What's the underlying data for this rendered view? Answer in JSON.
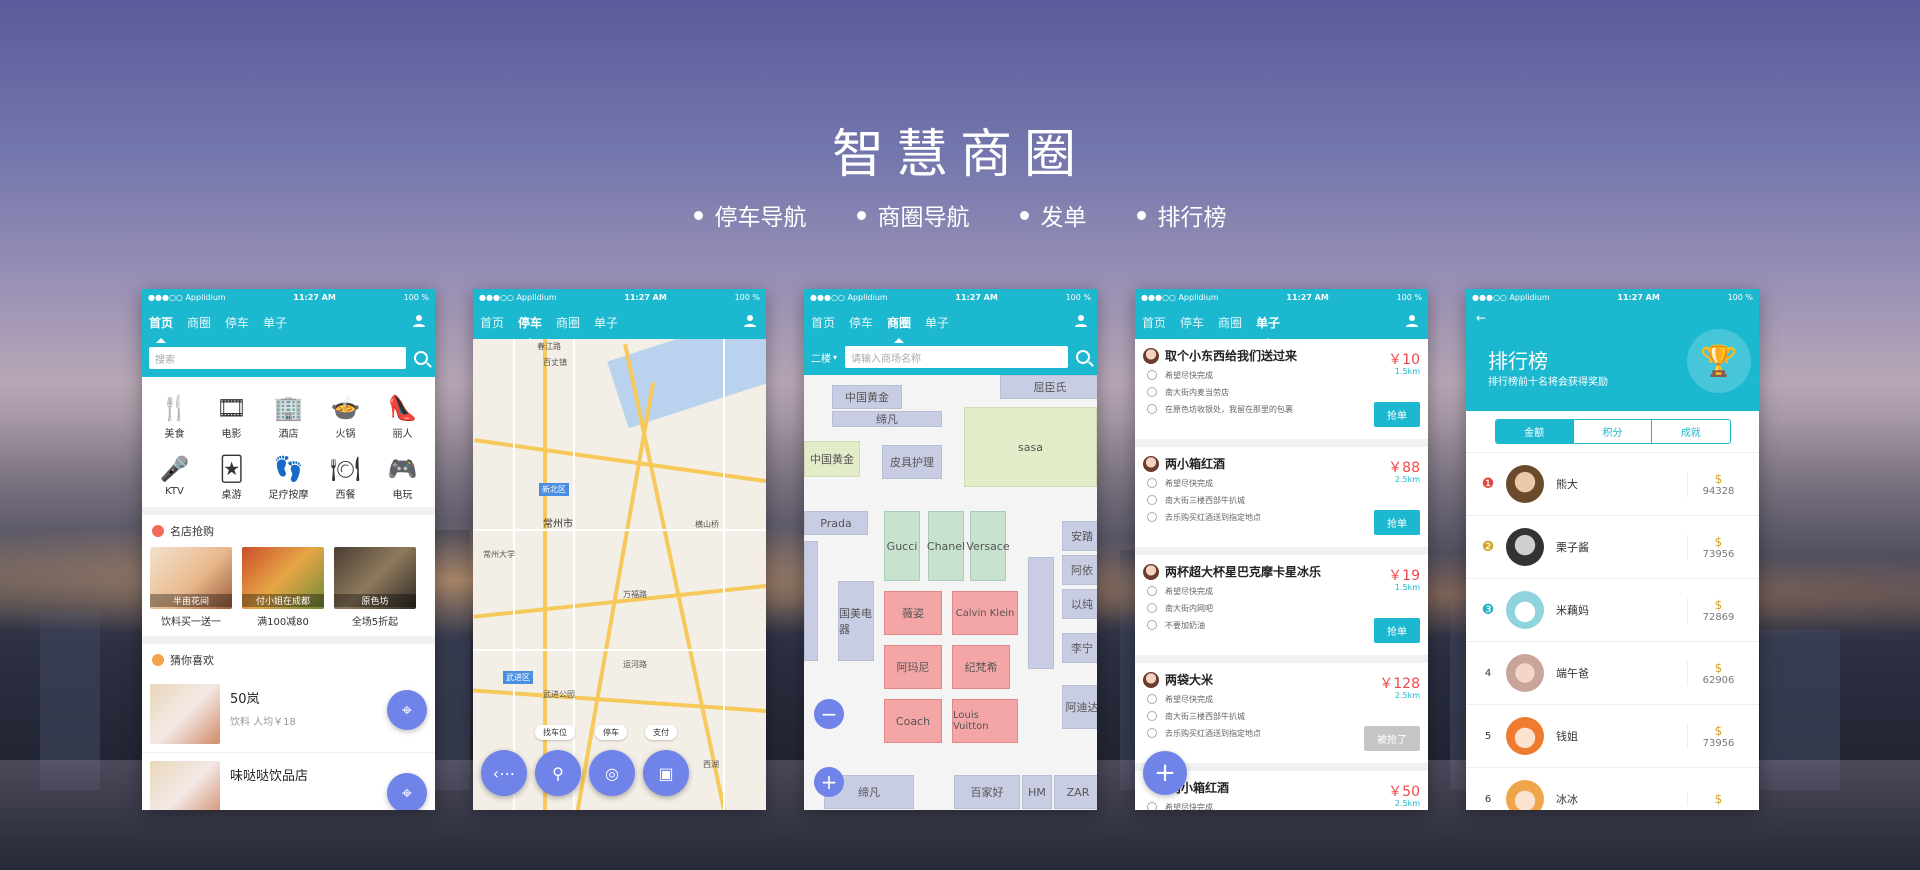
{
  "headline": "智慧商圈",
  "bullets": [
    "停车导航",
    "商圈导航",
    "发单",
    "排行榜"
  ],
  "status": {
    "carrier": "●●●○○ Applidium",
    "time": "11:27 AM",
    "battery": "100 %"
  },
  "nav": [
    "首页",
    "商圈",
    "停车",
    "单子"
  ],
  "nav2": [
    "首页",
    "停车",
    "商圈",
    "单子"
  ],
  "p1": {
    "search_placeholder": "搜索",
    "cats": [
      {
        "label": "美食",
        "icon": "🍴"
      },
      {
        "label": "电影",
        "icon": "🎞"
      },
      {
        "label": "酒店",
        "icon": "🏢"
      },
      {
        "label": "火锅",
        "icon": "🍲"
      },
      {
        "label": "丽人",
        "icon": "👠"
      },
      {
        "label": "KTV",
        "icon": "🎤"
      },
      {
        "label": "桌游",
        "icon": "🃏"
      },
      {
        "label": "足疗按摩",
        "icon": "👣"
      },
      {
        "label": "西餐",
        "icon": "🍽"
      },
      {
        "label": "电玩",
        "icon": "🎮"
      }
    ],
    "sec1": "名店抢购",
    "deals": [
      {
        "tag": "半亩花间",
        "cap": "饮料买一送一"
      },
      {
        "tag": "付小姐在成都",
        "cap": "满100减80"
      },
      {
        "tag": "原色坊",
        "cap": "全场5折起"
      }
    ],
    "sec2": "猜你喜欢",
    "shops": [
      {
        "name": "50岚",
        "sub": "饮料  人均￥18"
      },
      {
        "name": "味哒哒饮品店",
        "sub": ""
      }
    ]
  },
  "p2": {
    "labels": [
      "春江路",
      "百丈镇",
      "常州市",
      "新北区",
      "武进区",
      "常州大学",
      "武进公园",
      "横山桥",
      "万福路",
      "西湖",
      "运河路"
    ],
    "chips": [
      "找车位",
      "停车",
      "支付"
    ]
  },
  "p3": {
    "floor": "二楼",
    "search_placeholder": "请输入商场名称",
    "shops": [
      "中国黄金",
      "屈臣氏",
      "缔凡",
      "中国黄金",
      "皮具护理",
      "sasa",
      "Prada",
      "Gucci",
      "Chanel",
      "Versace",
      "安踏",
      "阿依",
      "以纯",
      "李宁",
      "薇姿",
      "Calvin Klein",
      "国美电器",
      "阿玛尼",
      "纪梵希",
      "Coach",
      "Louis Vuitton",
      "阿迪达",
      "百家好",
      "HM",
      "ZAR",
      "缔凡"
    ]
  },
  "p4": {
    "orders": [
      {
        "title": "取个小东西给我们送过来",
        "price": "￥10",
        "km": "1.5km",
        "lines": [
          "希望尽快完成",
          "南大街内麦当劳店",
          "在原色坊收银处，我留在那里的包裹"
        ],
        "btn": "抢单"
      },
      {
        "title": "两小箱红酒",
        "price": "￥88",
        "km": "2.5km",
        "lines": [
          "希望尽快完成",
          "南大街三楼西部牛扒城",
          "去乐购买红酒送到指定地点"
        ],
        "btn": "抢单"
      },
      {
        "title": "两杯超大杯星巴克摩卡星冰乐",
        "price": "￥19",
        "km": "1.5km",
        "lines": [
          "希望尽快完成",
          "南大街内网吧",
          "不要加奶油"
        ],
        "btn": "抢单"
      },
      {
        "title": "两袋大米",
        "price": "￥128",
        "km": "2.5km",
        "lines": [
          "希望尽快完成",
          "南大街三楼西部牛扒城",
          "去乐购买红酒送到指定地点"
        ],
        "btn": "被抢了"
      },
      {
        "title": "两小箱红酒",
        "price": "￥50",
        "km": "2.5km",
        "lines": [
          "希望尽快完成"
        ],
        "btn": ""
      }
    ]
  },
  "p5": {
    "back": "←",
    "title": "排行榜",
    "subtitle": "排行榜前十名将会获得奖励",
    "tabs": [
      "金额",
      "积分",
      "成就"
    ],
    "ranks": [
      {
        "no": "1",
        "name": "熊大",
        "score": "94328"
      },
      {
        "no": "2",
        "name": "栗子酱",
        "score": "73956"
      },
      {
        "no": "3",
        "name": "米藕妈",
        "score": "72869"
      },
      {
        "no": "4",
        "name": "端午爸",
        "score": "62906"
      },
      {
        "no": "5",
        "name": "钱姐",
        "score": "73956"
      },
      {
        "no": "6",
        "name": "冰冰",
        "score": ""
      }
    ]
  }
}
